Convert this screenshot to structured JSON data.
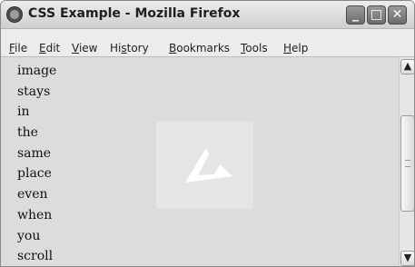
{
  "window": {
    "title": "CSS Example - Mozilla Firefox",
    "controls": {
      "minimize": "_",
      "maximize": "□",
      "close": "✕"
    }
  },
  "menu": [
    {
      "accel": "F",
      "rest": "ile"
    },
    {
      "accel": "E",
      "rest": "dit"
    },
    {
      "accel": "V",
      "rest": "iew"
    },
    {
      "pre": "Hi",
      "accel": "s",
      "rest": "tory"
    },
    {
      "accel": "B",
      "rest": "ookmarks"
    },
    {
      "accel": "T",
      "rest": "ools"
    },
    {
      "accel": "H",
      "rest": "elp"
    }
  ],
  "content": {
    "words": [
      "image",
      "stays",
      "in",
      "the",
      "same",
      "place",
      "even",
      "when",
      "you",
      "scroll"
    ]
  },
  "scrollbar": {
    "up": "▲",
    "down": "▼"
  }
}
